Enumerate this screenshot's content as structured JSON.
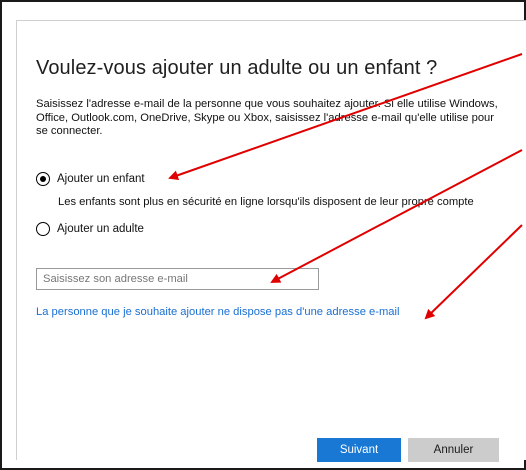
{
  "dialog": {
    "title": "Voulez-vous ajouter un adulte ou un enfant ?",
    "description": "Saisissez l'adresse e-mail de la personne que vous souhaitez ajouter. Si elle utilise Windows, Office, Outlook.com, OneDrive, Skype ou Xbox, saisissez l'adresse e-mail qu'elle utilise pour se connecter."
  },
  "options": {
    "child": {
      "label": "Ajouter un enfant",
      "selected": true,
      "hint": "Les enfants sont plus en sécurité en ligne lorsqu'ils disposent de leur propre compte"
    },
    "adult": {
      "label": "Ajouter un adulte",
      "selected": false
    }
  },
  "email": {
    "value": "",
    "placeholder": "Saisissez son adresse e-mail"
  },
  "links": {
    "no_email": "La personne que je souhaite ajouter ne dispose pas d'une adresse e-mail"
  },
  "buttons": {
    "next": "Suivant",
    "cancel": "Annuler"
  },
  "colors": {
    "accent": "#1978d4",
    "link": "#1a6fd1",
    "annotation_arrow": "#e00000",
    "cancel_button": "#cccccc"
  }
}
